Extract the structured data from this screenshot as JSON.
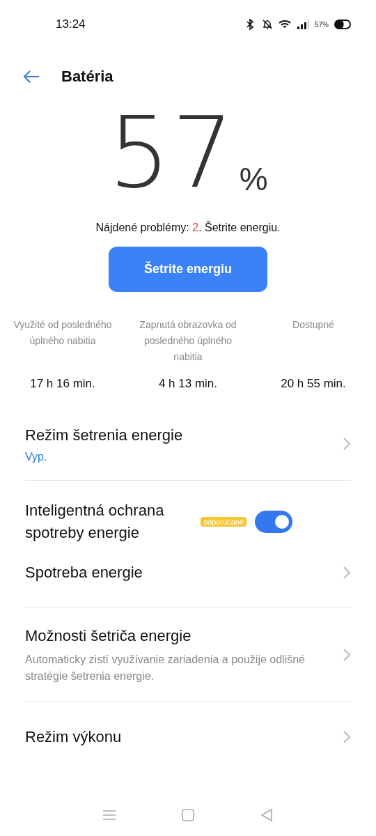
{
  "status_bar": {
    "time": "13:24",
    "battery_text": "57%"
  },
  "header": {
    "title": "Batéria"
  },
  "battery": {
    "value": "57",
    "unit": "%"
  },
  "problems": {
    "prefix": "Nájdené problémy: ",
    "count": "2",
    "suffix": ". Šetrite energiu."
  },
  "save_button": "Šetrite energiu",
  "stats": [
    {
      "label": "Využité od posledného úplného nabitia",
      "value": "17 h 16 min."
    },
    {
      "label": "Zapnutá obrazovka od posledného úplného nabitia",
      "value": "4 h 13 min."
    },
    {
      "label": "Dostupné",
      "value": "20 h 55 min."
    }
  ],
  "settings_groups": [
    {
      "items": [
        {
          "kind": "link",
          "title": "Režim šetrenia energie",
          "value": "Vyp."
        }
      ]
    },
    {
      "items": [
        {
          "kind": "toggle",
          "title": "Inteligentná ochrana spotreby energie",
          "badge": "odporúčané",
          "on": true
        },
        {
          "kind": "link",
          "title": "Spotreba energie"
        }
      ]
    },
    {
      "items": [
        {
          "kind": "link",
          "title": "Možnosti šetriča energie",
          "description": "Automaticky zistí využívanie zariadenia a použije odlišné stratégie šetrenia energie."
        }
      ]
    },
    {
      "items": [
        {
          "kind": "link",
          "title": "Režim výkonu"
        }
      ]
    }
  ]
}
